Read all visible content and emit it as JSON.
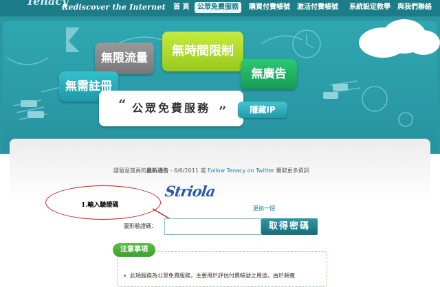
{
  "header": {
    "logo_top": "Tenacy",
    "tagline": "Rediscover the Internet",
    "nav": [
      {
        "label": "首 頁",
        "active": false
      },
      {
        "label": "公眾免費服務",
        "active": true
      },
      {
        "label": "購買付費帳號",
        "active": false
      },
      {
        "label": "激活付費帳號",
        "active": false
      },
      {
        "label": "系統設定教學",
        "active": false
      },
      {
        "label": "與我們聯絡",
        "active": false
      }
    ]
  },
  "hero": {
    "bubble_unlimited_traffic": "無限流量",
    "bubble_no_time_limit": "無時間限制",
    "bubble_no_registration": "無需註冊",
    "bubble_no_ads": "無廣告",
    "card_title": "公眾免費服務",
    "quote_open": "“",
    "quote_close": "”",
    "hide_ip": "隱藏IP"
  },
  "main": {
    "notice_prefix": "請留意首頁的",
    "notice_bold": "最新通告",
    "notice_date": " - 6/6/2011 或 ",
    "notice_link": "Follow Tenacy on Twitter",
    "notice_suffix": " 獲取更多資訊",
    "captcha_text": "Striola",
    "refresh_link": "更換一個",
    "captcha_label": "圖形驗證碼：",
    "captcha_input_value": "",
    "submit_button": "取得密碼",
    "annotation": "1.輸入驗證碼",
    "notes_title": "注意事項",
    "note_1": "此項服務為公眾免費服務，主要用於評估付費帳號之用途。由於頻寬"
  },
  "colors": {
    "header_bg": "#1c7d88",
    "hero_bg": "#2b97a1",
    "button_bg": "#176c78",
    "annotation_red": "#d01c1c",
    "notes_green": "#3f9f30"
  }
}
